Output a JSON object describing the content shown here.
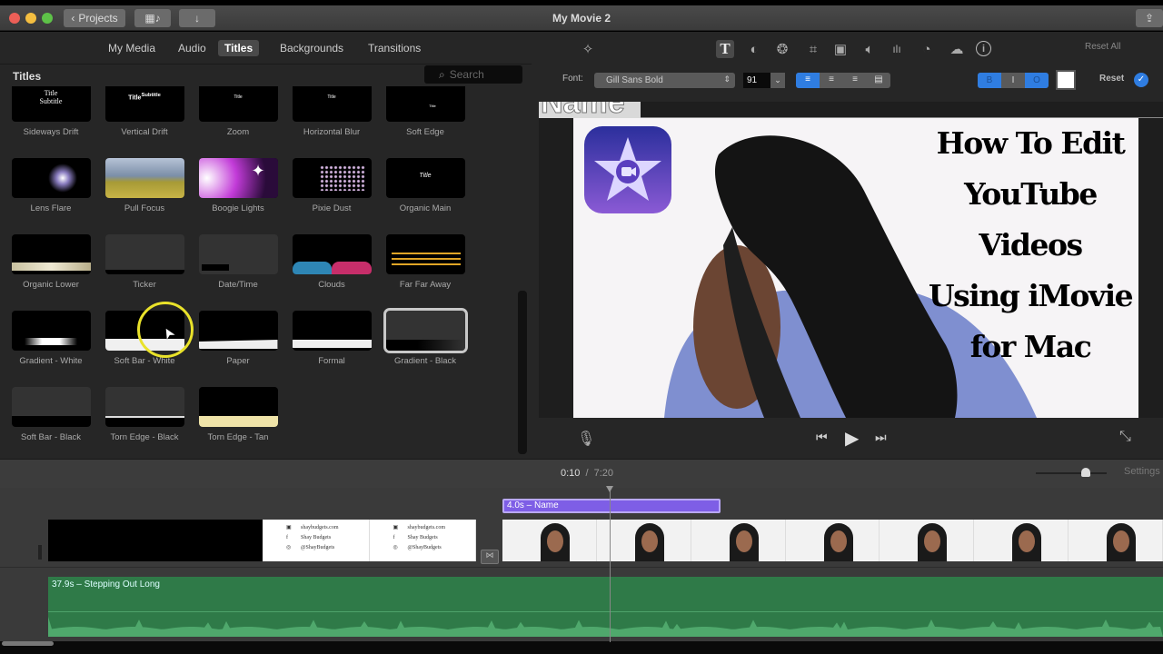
{
  "window": {
    "title": "My Movie 2",
    "projects_button": "Projects",
    "traffic_colors": [
      "#ec5f57",
      "#f4be40",
      "#5ec248"
    ]
  },
  "browser": {
    "tabs": [
      {
        "label": "My Media",
        "active": false
      },
      {
        "label": "Audio",
        "active": false
      },
      {
        "label": "Titles",
        "active": true
      },
      {
        "label": "Backgrounds",
        "active": false
      },
      {
        "label": "Transitions",
        "active": false
      }
    ],
    "panel_title": "Titles",
    "search_placeholder": "Search",
    "titles": [
      {
        "label": "Sideways Drift",
        "style": "sideways"
      },
      {
        "label": "Vertical Drift",
        "style": "vertical"
      },
      {
        "label": "Zoom",
        "style": "small"
      },
      {
        "label": "Horizontal Blur",
        "style": "small"
      },
      {
        "label": "Soft Edge",
        "style": "softedge"
      },
      {
        "label": "Lens Flare",
        "style": "lensflare"
      },
      {
        "label": "Pull Focus",
        "style": "pullfocus"
      },
      {
        "label": "Boogie Lights",
        "style": "boogie"
      },
      {
        "label": "Pixie Dust",
        "style": "pixie"
      },
      {
        "label": "Organic Main",
        "style": "organicmain"
      },
      {
        "label": "Organic Lower",
        "style": "organiclower"
      },
      {
        "label": "Ticker",
        "style": "ticker"
      },
      {
        "label": "Date/Time",
        "style": "datetime"
      },
      {
        "label": "Clouds",
        "style": "clouds"
      },
      {
        "label": "Far Far Away",
        "style": "farfaraway"
      },
      {
        "label": "Gradient - White",
        "style": "gradwhite"
      },
      {
        "label": "Soft Bar - White",
        "style": "softbarwhite"
      },
      {
        "label": "Paper",
        "style": "paper"
      },
      {
        "label": "Formal",
        "style": "formal"
      },
      {
        "label": "Gradient - Black",
        "style": "gradblack",
        "selected": true
      },
      {
        "label": "Soft Bar - Black",
        "style": "softbarblack"
      },
      {
        "label": "Torn Edge - Black",
        "style": "tornblack"
      },
      {
        "label": "Torn Edge - Tan",
        "style": "torntan"
      }
    ]
  },
  "inspector": {
    "tools": [
      "magic-wand",
      "text",
      "color-balance",
      "color-correction",
      "crop",
      "stabilization",
      "volume",
      "equalizer",
      "speed",
      "clip-filter",
      "info"
    ],
    "reset_all": "Reset All",
    "font_label": "Font:",
    "font_value": "Gill Sans Bold",
    "size_value": "91",
    "style_buttons": [
      "B",
      "I",
      "O"
    ],
    "reset_label": "Reset",
    "accent": "#2f7de1"
  },
  "viewer": {
    "overlay_partial_title": "Name",
    "thumbnail_lines": [
      "How To Edit",
      "YouTube",
      "Videos",
      "Using iMovie",
      "for Mac"
    ]
  },
  "timeline": {
    "current_time": "0:10",
    "separator": "/",
    "total_time": "7:20",
    "settings_label": "Settings",
    "zoom_level": 0.7,
    "title_clip": "4.0s – Name",
    "audio_clip": "37.9s – Stepping Out Long",
    "social_card": [
      "shaybudgets.com",
      "Shay Budgets",
      "@ShayBudgets"
    ],
    "title_color": "#7e5ee6",
    "audio_color": "#2f7a48"
  }
}
